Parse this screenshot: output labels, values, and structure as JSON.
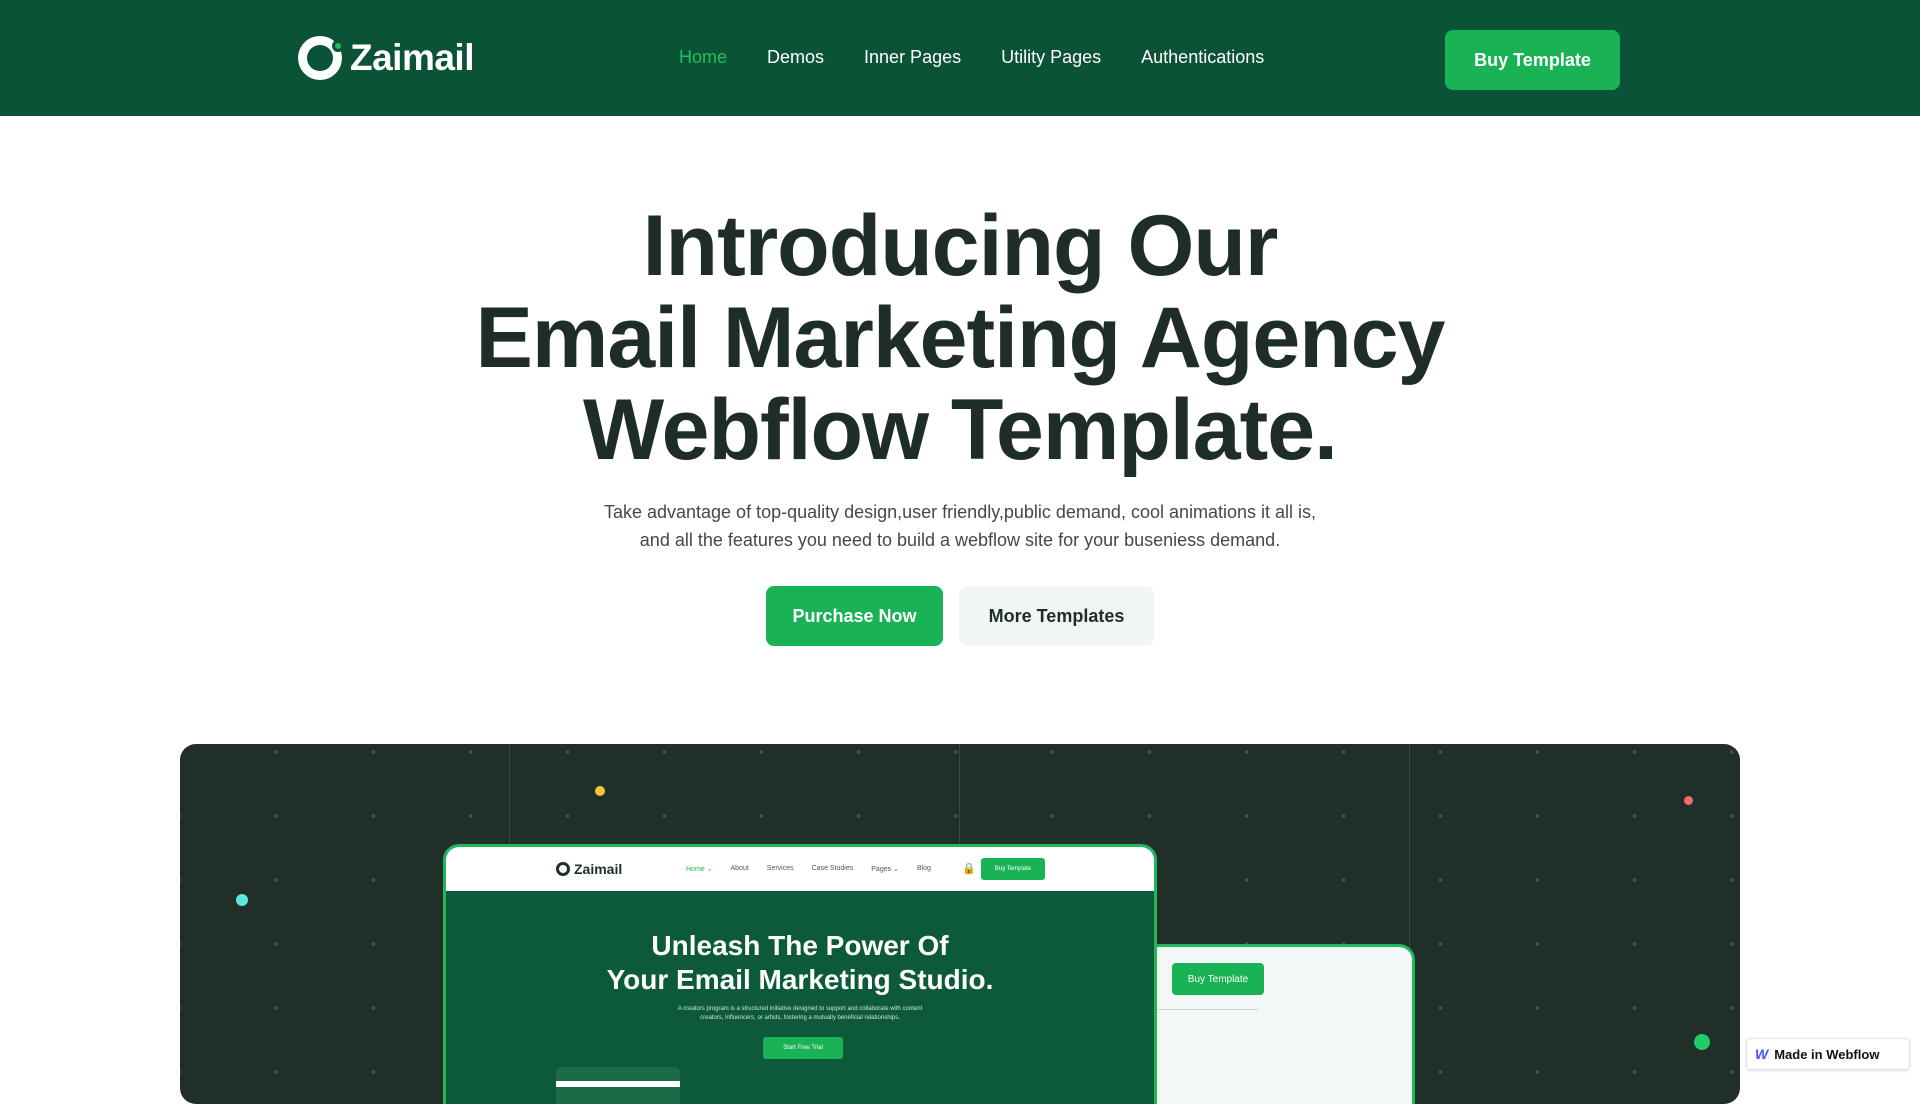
{
  "header": {
    "brand": "Zaimail",
    "nav": [
      {
        "label": "Home",
        "active": true
      },
      {
        "label": "Demos",
        "active": false
      },
      {
        "label": "Inner Pages",
        "active": false
      },
      {
        "label": "Utility Pages",
        "active": false
      },
      {
        "label": "Authentications",
        "active": false
      }
    ],
    "buy_label": "Buy Template"
  },
  "hero": {
    "title_lines": [
      "Introducing Our",
      "Email Marketing Agency",
      "Webflow Template."
    ],
    "subtitle_lines": [
      "Take advantage of top-quality design,user friendly,public demand, cool animations it all is,",
      "and all the features you need to build a webflow site for your buseniess demand."
    ],
    "primary_cta": "Purchase Now",
    "secondary_cta": "More Templates"
  },
  "preview": {
    "brand": "Zaimail",
    "nav": [
      "Home ⌄",
      "About",
      "Services",
      "Case Studies",
      "Pages ⌄",
      "Blog"
    ],
    "buy_label": "Buy Template",
    "title_lines": [
      "Unleash The Power Of",
      "Your Email Marketing Studio."
    ],
    "description_lines": [
      "A creators program is a structured initiative designed to support and collaborate with content",
      "creators, influencers, or artists, fostering a mutually beneficial relationships."
    ],
    "trial_label": "Start Free Trial",
    "back_buy_label": "Buy Template"
  },
  "badge": {
    "label": "Made in Webflow"
  },
  "colors": {
    "header_bg": "#0b5337",
    "accent": "#19b356",
    "dark_panel": "#203028"
  }
}
